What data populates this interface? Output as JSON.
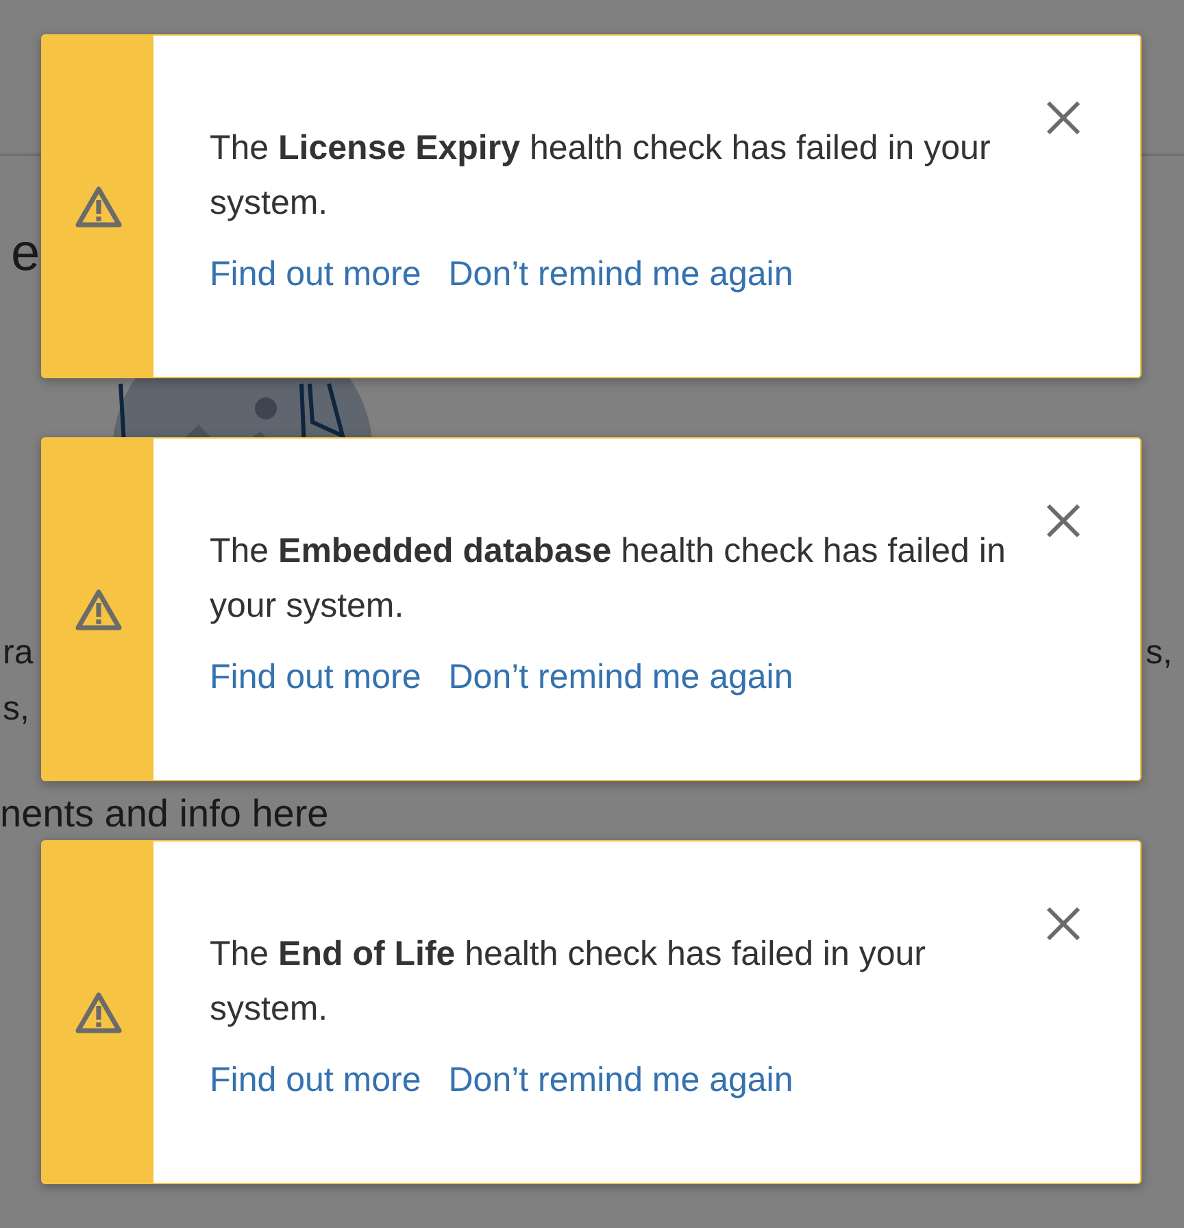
{
  "background": {
    "heading": "e",
    "left_fragments": [
      "ra",
      "s,"
    ],
    "right_fragments": [
      "s,"
    ],
    "subheading": "nents and info here"
  },
  "notifications": [
    {
      "kind": "warning",
      "message": "The **License Expiry** health check has failed in your system.",
      "links": [
        "Find out more",
        "Don’t remind me again"
      ]
    },
    {
      "kind": "warning",
      "message": "The **Embedded database** health check has failed in your system.",
      "links": [
        "Find out more",
        "Don’t remind me again"
      ]
    },
    {
      "kind": "warning",
      "message": "The **End of Life** health check has failed in your system.",
      "links": [
        "Find out more",
        "Don’t remind me again"
      ]
    }
  ]
}
